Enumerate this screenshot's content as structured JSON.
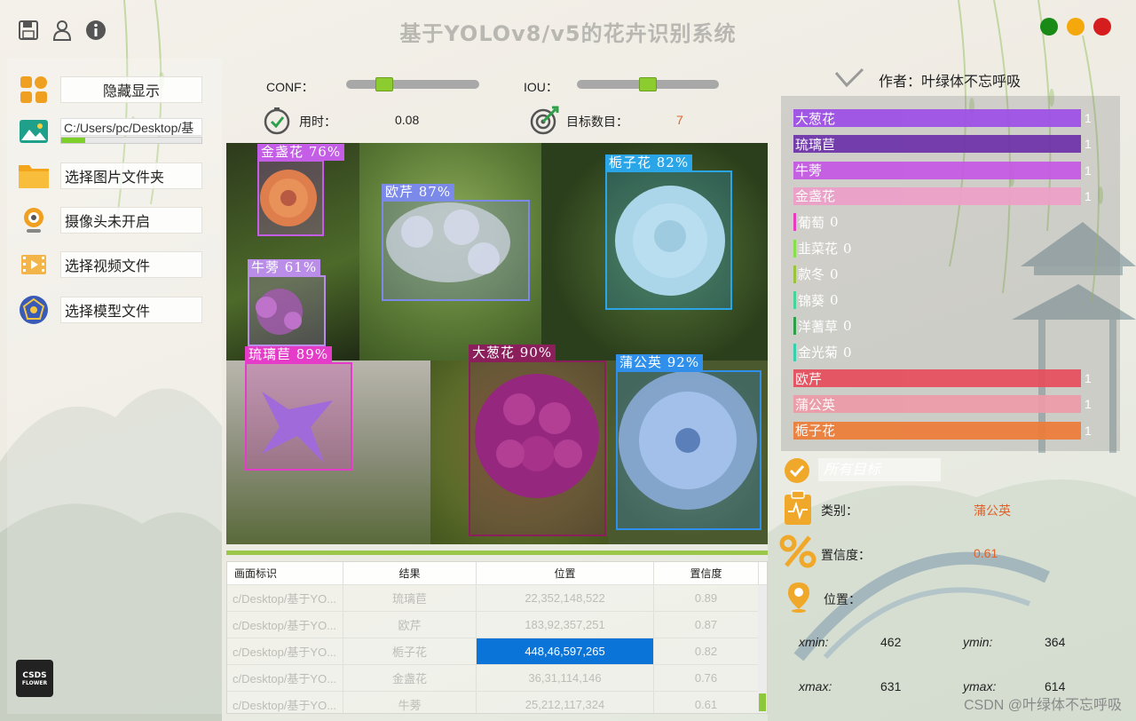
{
  "app": {
    "title": "基于YOLOv8/v5的花卉识别系统",
    "window_buttons": [
      {
        "name": "maximize",
        "color": "#1a8a17"
      },
      {
        "name": "minimize",
        "color": "#f4a80c"
      },
      {
        "name": "close",
        "color": "#d51d1d"
      }
    ]
  },
  "left": {
    "hide_display": "隐藏显示",
    "path_value": "C:/Users/pc/Desktop/基",
    "path_progress": 0.17,
    "select_folder": "选择图片文件夹",
    "camera": "摄像头未开启",
    "select_video": "选择视频文件",
    "select_model": "选择模型文件",
    "logo_text_1": "CSDS",
    "logo_text_2": "FLOWER"
  },
  "controls": {
    "conf_label": "CONF：",
    "conf_value": 0.25,
    "iou_label": "IOU：",
    "iou_value": 0.5,
    "time_label": "用时：",
    "time_value": "0.08",
    "count_label": "目标数目：",
    "count_value": "7"
  },
  "detections": [
    {
      "label": "金盏花  76%",
      "color": "#c45ee6"
    },
    {
      "label": "欧芹  87%",
      "color": "#7b89e8"
    },
    {
      "label": "栀子花  82%",
      "color": "#2aa5e8"
    },
    {
      "label": "牛蒡  61%",
      "color": "#b98de8"
    },
    {
      "label": "琉璃苣  89%",
      "color": "#e43cc8"
    },
    {
      "label": "大葱花  90%",
      "color": "#8a1f5c"
    },
    {
      "label": "蒲公英  92%",
      "color": "#2f8fea"
    }
  ],
  "table": {
    "headers": [
      "画面标识",
      "结果",
      "位置",
      "置信度"
    ],
    "rows": [
      [
        "c/Desktop/基于YO...",
        "琉璃苣",
        "22,352,148,522",
        "0.89"
      ],
      [
        "c/Desktop/基于YO...",
        "欧芹",
        "183,92,357,251",
        "0.87"
      ],
      [
        "c/Desktop/基于YO...",
        "栀子花",
        "448,46,597,265",
        "0.82"
      ],
      [
        "c/Desktop/基于YO...",
        "金盏花",
        "36,31,114,146",
        "0.76"
      ],
      [
        "c/Desktop/基于YO...",
        "牛蒡",
        "25,212,117,324",
        "0.61"
      ]
    ],
    "selected_row": 2
  },
  "right": {
    "author": "作者：叶绿体不忘呼吸",
    "classes": [
      {
        "name": "大葱花",
        "count": "1",
        "color": "#9b4be8"
      },
      {
        "name": "琉璃苣",
        "count": "1",
        "color": "#6a2ea8"
      },
      {
        "name": "牛蒡",
        "count": "1",
        "color": "#c455e6"
      },
      {
        "name": "金盏花",
        "count": "1",
        "color": "#ee9ec8"
      },
      {
        "name": "葡萄",
        "count": "0",
        "color": "#ea3cc0"
      },
      {
        "name": "韭菜花",
        "count": "0",
        "color": "#86e04a"
      },
      {
        "name": "款冬",
        "count": "0",
        "color": "#9bc43a"
      },
      {
        "name": "锦葵",
        "count": "0",
        "color": "#46d49a"
      },
      {
        "name": "洋蓍草",
        "count": "0",
        "color": "#2e9e4a"
      },
      {
        "name": "金光菊",
        "count": "0",
        "color": "#36d0b0"
      },
      {
        "name": "欧芹",
        "count": "1",
        "color": "#e84a5a"
      },
      {
        "name": "蒲公英",
        "count": "1",
        "color": "#ee9aa6"
      },
      {
        "name": "栀子花",
        "count": "1",
        "color": "#ee7a34"
      }
    ],
    "target_select": "所有目标",
    "category_label": "类别：",
    "category_value": "蒲公英",
    "confidence_label": "置信度：",
    "confidence_value": "0.61",
    "position_label": "位置：",
    "xmin_label": "xmin:",
    "xmin_value": "462",
    "ymin_label": "ymin:",
    "ymin_value": "364",
    "xmax_label": "xmax:",
    "xmax_value": "631",
    "ymax_label": "ymax:",
    "ymax_value": "614",
    "watermark": "CSDN @叶绿体不忘呼吸"
  }
}
